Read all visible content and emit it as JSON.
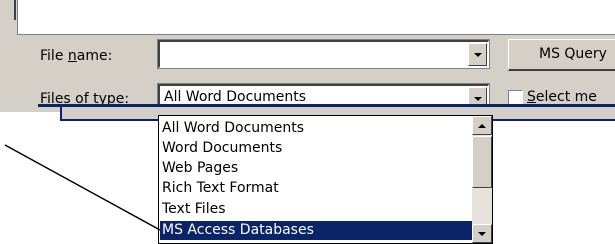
{
  "dialog": {
    "file_name_label_prefix": "File ",
    "file_name_label_key": "n",
    "file_name_label_suffix": "ame:",
    "file_name_value": "",
    "files_of_type_label_prefix": "Files of ",
    "files_of_type_label_key": "t",
    "files_of_type_label_suffix": "ype:",
    "files_of_type_value": "All Word Documents",
    "ms_query_label": "MS Query",
    "select_label_prefix": "S",
    "select_label_suffix": "elect me"
  },
  "type_list": {
    "items": [
      "All Word Documents",
      "Word Documents",
      "Web Pages",
      "Rich Text Format",
      "Text Files",
      "MS Access Databases"
    ],
    "selected_index": 5
  },
  "colors": {
    "dialog_bg": "#d4d0c8",
    "selection": "#0a246a"
  }
}
